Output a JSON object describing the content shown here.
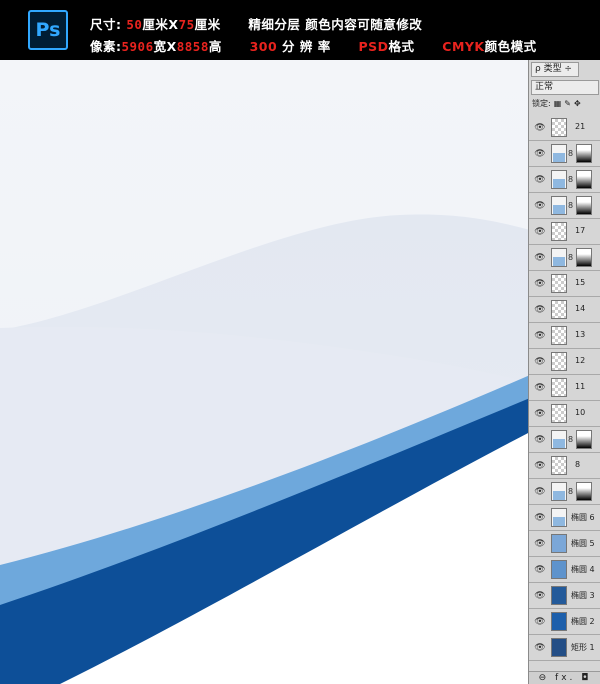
{
  "header": {
    "logo_text": "Ps",
    "line1": {
      "size_label": "尺寸:",
      "width": "50",
      "unit1": "厘米X",
      "height": "75",
      "unit2": "厘米",
      "desc": "精细分层 颜色内容可随意修改"
    },
    "line2": {
      "pixel_label": "像素:",
      "px_w": "5906",
      "unit_w": "宽X",
      "px_h": "8858",
      "unit_h": "高",
      "dpi": "300",
      "dpi_label": "分 辨 率",
      "format": "PSD",
      "format_label": "格式",
      "color_mode": "CMYK",
      "color_mode_label": "颜色模式"
    },
    "colors": {
      "background": "#000000",
      "text": "#ffffff",
      "accent": "#e8231e",
      "ps_blue": "#31a8ff"
    }
  },
  "layers_panel": {
    "filter_label": "ρ 类型 ÷",
    "blend_mode": "正常",
    "lock_label": "锁定:",
    "lock_icons": [
      "lock-transparent-icon",
      "lock-paint-icon",
      "lock-move-icon"
    ],
    "layers": [
      {
        "name": "21",
        "thumb": "transparent",
        "mask": false
      },
      {
        "name": "",
        "thumb": "shape1",
        "mask": true
      },
      {
        "name": "",
        "thumb": "shape1",
        "mask": true
      },
      {
        "name": "",
        "thumb": "shape1",
        "mask": true
      },
      {
        "name": "17",
        "thumb": "transparent",
        "mask": false
      },
      {
        "name": "",
        "thumb": "shape1",
        "mask": true
      },
      {
        "name": "15",
        "thumb": "transparent",
        "mask": false
      },
      {
        "name": "14",
        "thumb": "transparent",
        "mask": false
      },
      {
        "name": "13",
        "thumb": "transparent",
        "mask": false
      },
      {
        "name": "12",
        "thumb": "transparent",
        "mask": false
      },
      {
        "name": "11",
        "thumb": "transparent",
        "mask": false
      },
      {
        "name": "10",
        "thumb": "transparent",
        "mask": false
      },
      {
        "name": "",
        "thumb": "shape1",
        "mask": true
      },
      {
        "name": "8",
        "thumb": "transparent",
        "mask": false
      },
      {
        "name": "",
        "thumb": "shape1",
        "mask": true
      },
      {
        "name": "椭圆 6",
        "thumb": "shape1",
        "mask": false
      },
      {
        "name": "椭圆 5",
        "thumb": "shape5",
        "mask": false
      },
      {
        "name": "椭圆 4",
        "thumb": "shape4",
        "mask": false
      },
      {
        "name": "椭圆 3",
        "thumb": "shape3",
        "mask": false
      },
      {
        "name": "椭圆 2",
        "thumb": "shape2",
        "mask": false
      },
      {
        "name": "矩形 1",
        "thumb": "rect",
        "mask": false
      }
    ],
    "bottom_icons": "⊖ fx. ◘"
  },
  "canvas": {
    "colors": {
      "sky": "#f4f6fa",
      "hill": "#e6eaf2",
      "light_blue": "#6ea8dc",
      "dark_blue": "#0d4f98",
      "white": "#ffffff"
    }
  }
}
